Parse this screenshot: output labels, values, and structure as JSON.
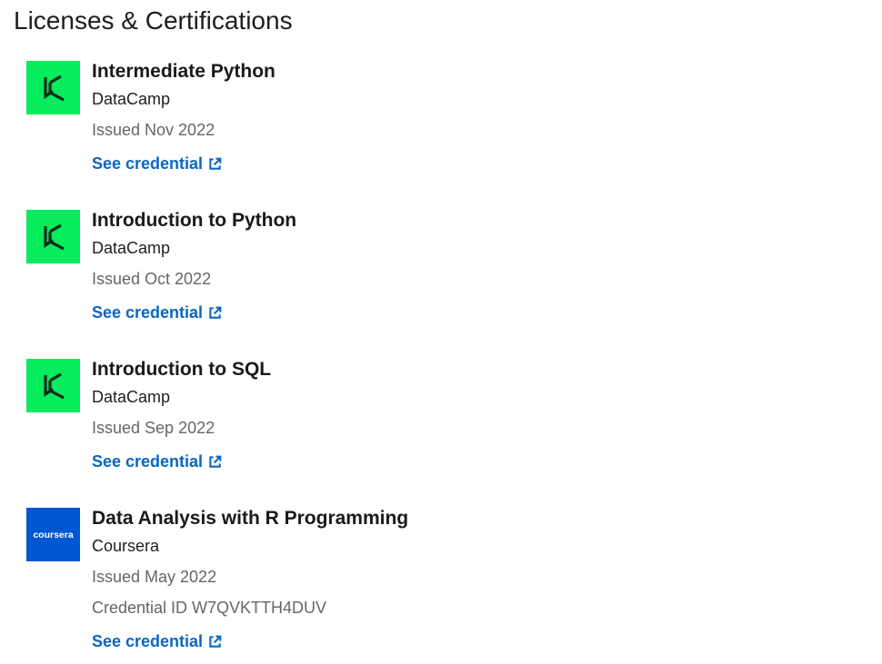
{
  "section": {
    "title": "Licenses & Certifications"
  },
  "colors": {
    "datacamp_logo_bg": "#05ec5d",
    "datacamp_logo_mark": "#0b2a1b",
    "coursera_logo_bg": "#0156d2",
    "link": "#0a66c2",
    "meta_text": "#666666"
  },
  "certifications": [
    {
      "title": "Intermediate Python",
      "issuer": "DataCamp",
      "issued": "Issued Nov 2022",
      "credential_link": "See credential",
      "logo_icon": "datacamp-logo-icon"
    },
    {
      "title": "Introduction to Python",
      "issuer": "DataCamp",
      "issued": "Issued Oct 2022",
      "credential_link": "See credential",
      "logo_icon": "datacamp-logo-icon"
    },
    {
      "title": "Introduction to SQL",
      "issuer": "DataCamp",
      "issued": "Issued Sep 2022",
      "credential_link": "See credential",
      "logo_icon": "datacamp-logo-icon"
    },
    {
      "title": "Data Analysis with R Programming",
      "issuer": "Coursera",
      "issued": "Issued May 2022",
      "credential_id": "Credential ID W7QVKTTH4DUV",
      "credential_link": "See credential",
      "logo_icon": "coursera-logo-icon",
      "logo_text": "coursera"
    }
  ],
  "icons": {
    "external_link": "external-link-icon"
  }
}
